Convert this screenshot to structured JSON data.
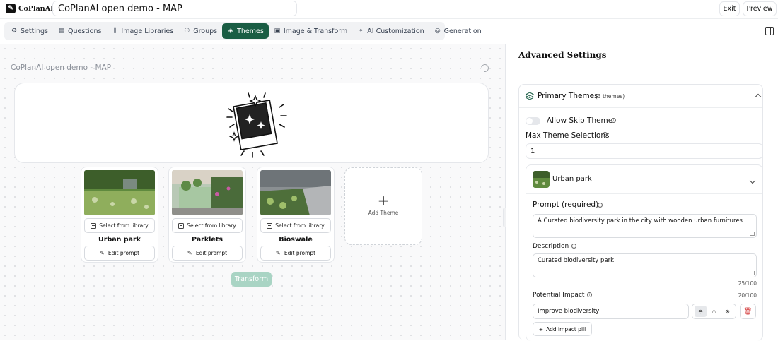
{
  "app": {
    "logo_text": "CoPlanAI",
    "project_title": "CoPlanAI open demo - MAP"
  },
  "header_buttons": {
    "exit": "Exit",
    "preview": "Preview"
  },
  "tabs": [
    {
      "label": "Settings",
      "icon": "gear-icon",
      "active": false
    },
    {
      "label": "Questions",
      "icon": "clipboard-icon",
      "active": false
    },
    {
      "label": "Image Libraries",
      "icon": "library-icon",
      "active": false
    },
    {
      "label": "Groups",
      "icon": "users-icon",
      "active": false
    },
    {
      "label": "Themes",
      "icon": "layers-icon",
      "active": true
    },
    {
      "label": "Image & Transform",
      "icon": "image-icon",
      "active": false
    },
    {
      "label": "AI Customization",
      "icon": "sparkle-icon",
      "active": false
    },
    {
      "label": "Generation",
      "icon": "generation-icon",
      "active": false
    }
  ],
  "canvas": {
    "title": "CoPlanAI open demo - MAP",
    "select_label": "Select from library",
    "edit_label": "Edit prompt",
    "add_theme_label": "Add Theme",
    "transform_label": "Transform",
    "themes": [
      {
        "name": "Urban park"
      },
      {
        "name": "Parklets"
      },
      {
        "name": "Bioswale"
      }
    ]
  },
  "advanced": {
    "title": "Advanced Settings",
    "primary_themes_label": "Primary Themes",
    "primary_themes_count": "(3 themes)",
    "allow_skip_label": "Allow Skip Theme",
    "allow_skip_enabled": false,
    "max_selections_label": "Max Theme Selections",
    "max_selections_value": "1",
    "theme": {
      "name": "Urban park",
      "prompt_label": "Prompt (required)",
      "prompt_value": "A Curated biodiversity park in the city with wooden urban furnitures",
      "description_label": "Description",
      "description_value": "Curated biodiversity park",
      "description_counter": "25/100",
      "impact_label": "Potential Impact",
      "impact_counter": "20/100",
      "impact_value": "Improve biodiversity",
      "add_pill_label": "Add impact pill"
    }
  },
  "colors": {
    "accent": "#1a5d44",
    "transform_disabled": "#a9d4c4",
    "danger": "#d64545"
  }
}
